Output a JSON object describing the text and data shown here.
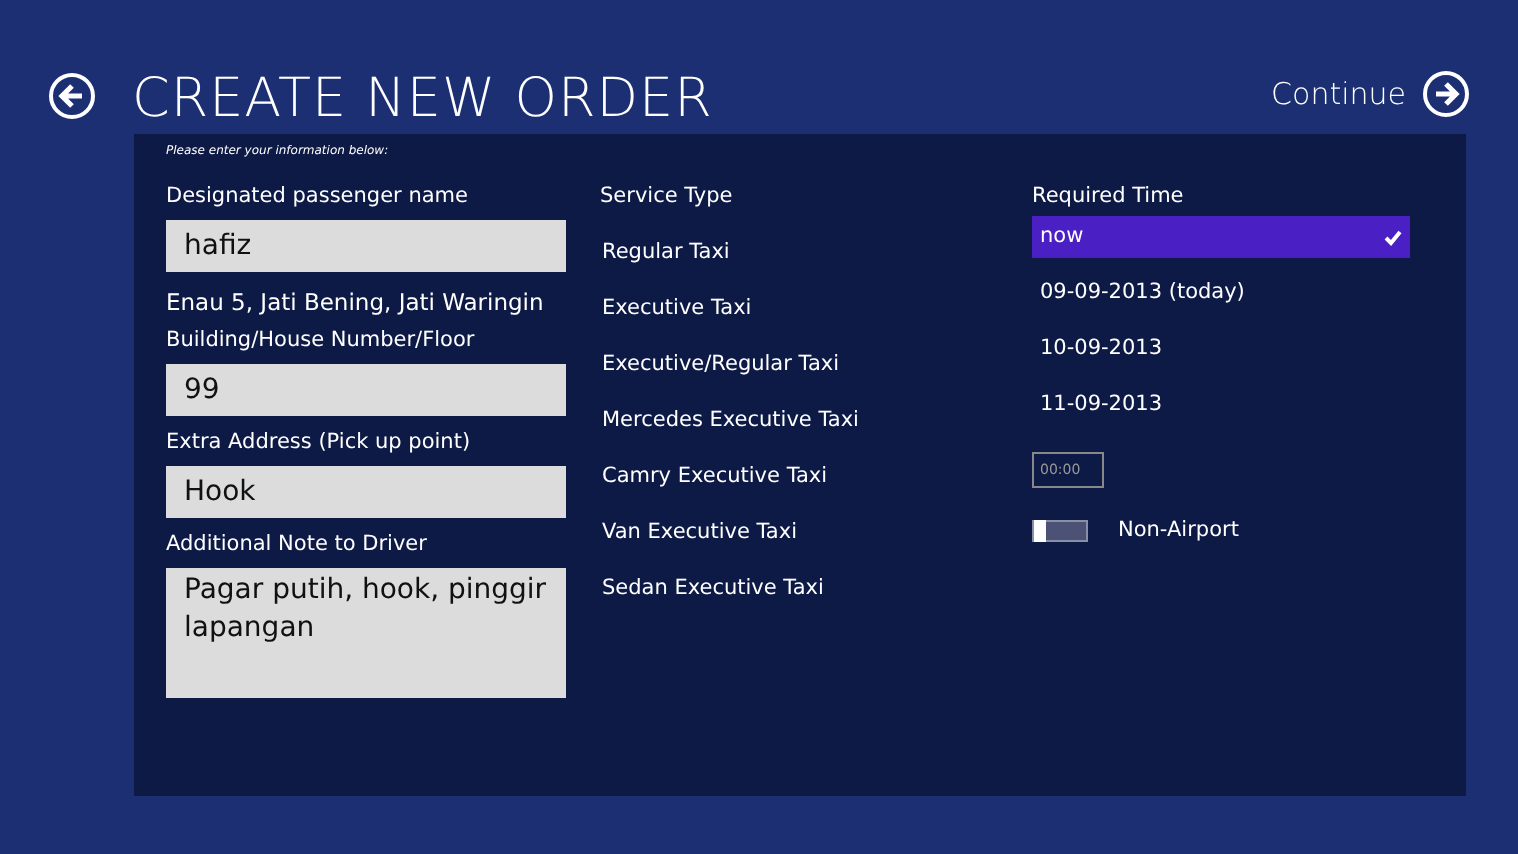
{
  "header": {
    "title": "CREATE NEW ORDER",
    "continue": "Continue"
  },
  "hint": "Please enter your information below:",
  "passenger": {
    "label": "Designated passenger name",
    "value": "hafiz"
  },
  "address": "Enau 5, Jati Bening, Jati Waringin",
  "building": {
    "label": "Building/House Number/Floor",
    "value": "99"
  },
  "extra": {
    "label": "Extra Address (Pick up point)",
    "value": "Hook"
  },
  "note": {
    "label": "Additional Note to Driver",
    "value": "Pagar putih, hook, pinggir lapangan"
  },
  "service": {
    "label": "Service Type",
    "items": [
      {
        "label": "Regular Taxi",
        "selected": false
      },
      {
        "label": "Executive Taxi",
        "selected": false
      },
      {
        "label": "Executive/Regular Taxi",
        "selected": false
      },
      {
        "label": "Mercedes Executive Taxi",
        "selected": false
      },
      {
        "label": "Camry Executive Taxi",
        "selected": false
      },
      {
        "label": "Van Executive Taxi",
        "selected": false
      },
      {
        "label": "Sedan Executive Taxi",
        "selected": false
      }
    ]
  },
  "time": {
    "label": "Required Time",
    "items": [
      {
        "label": "now",
        "selected": true
      },
      {
        "label": "09-09-2013 (today)",
        "selected": false
      },
      {
        "label": "10-09-2013",
        "selected": false
      },
      {
        "label": "11-09-2013",
        "selected": false
      }
    ],
    "time_field": {
      "placeholder": "00:00"
    },
    "toggle": {
      "label": "Non-Airport",
      "on": false
    }
  }
}
